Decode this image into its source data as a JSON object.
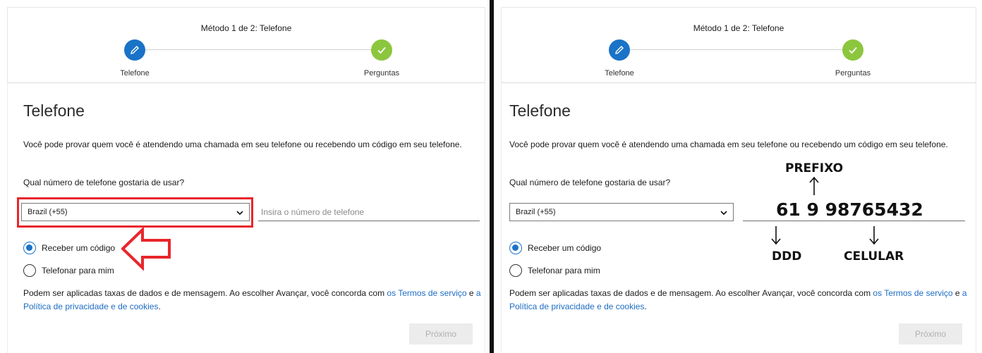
{
  "left": {
    "method_title": "Método 1 de 2: Telefone",
    "steps": [
      {
        "label": "Telefone"
      },
      {
        "label": "Perguntas"
      }
    ],
    "page_title": "Telefone",
    "description": "Você pode provar quem você é atendendo uma chamada em seu telefone ou recebendo um código em seu telefone.",
    "question": "Qual número de telefone gostaria de usar?",
    "country": "Brazil (+55)",
    "phone_placeholder": "Insira o número de telefone",
    "radio_options": [
      {
        "label": "Receber um código",
        "selected": true
      },
      {
        "label": "Telefonar para mim",
        "selected": false
      }
    ],
    "terms_prefix": "Podem ser aplicadas taxas de dados e de mensagem. Ao escolher Avançar, você concorda com ",
    "terms_link": "os Termos de serviço",
    "terms_and": " e ",
    "privacy_link": "a Política de privacidade e de cookies",
    "terms_suffix": ".",
    "next_button": "Próximo"
  },
  "right": {
    "method_title": "Método 1 de 2: Telefone",
    "steps": [
      {
        "label": "Telefone"
      },
      {
        "label": "Perguntas"
      }
    ],
    "page_title": "Telefone",
    "description": "Você pode provar quem você é atendendo uma chamada em seu telefone ou recebendo um código em seu telefone.",
    "question": "Qual número de telefone gostaria de usar?",
    "country": "Brazil (+55)",
    "radio_options": [
      {
        "label": "Receber um código",
        "selected": true
      },
      {
        "label": "Telefonar para mim",
        "selected": false
      }
    ],
    "terms_prefix": "Podem ser aplicadas taxas de dados e de mensagem. Ao escolher Avançar, você concorda com ",
    "terms_link": "os Termos de serviço",
    "terms_and": " e ",
    "privacy_link": "a Política de privacidade e de cookies",
    "terms_suffix": ".",
    "next_button": "Próximo"
  },
  "annotations": {
    "prefix_label": "PREFIXO",
    "phone_example": "61 9 98765432",
    "ddd_label": "DDD",
    "cellular_label": "CELULAR"
  },
  "colors": {
    "accent_blue": "#1a73c7",
    "step_green": "#8cc63e",
    "highlight_red": "#e8262b",
    "link_blue": "#1d6cc4"
  }
}
